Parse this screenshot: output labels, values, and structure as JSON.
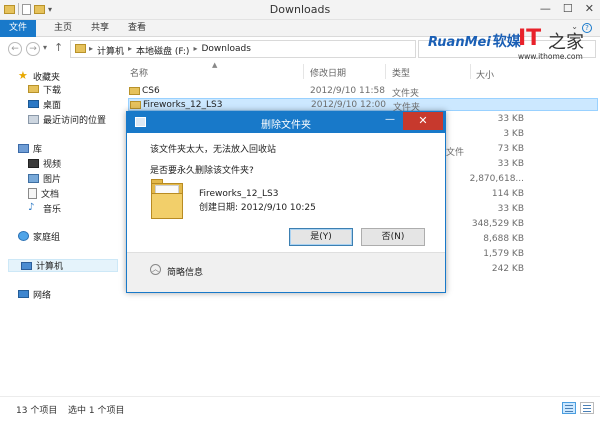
{
  "window": {
    "title": "Downloads",
    "controls": {
      "minimize": "—",
      "maximize": "☐",
      "close": "✕"
    }
  },
  "ribbon": {
    "tabs": [
      {
        "label": "文件",
        "active": true
      },
      {
        "label": "主页",
        "active": false
      },
      {
        "label": "共享",
        "active": false
      },
      {
        "label": "查看",
        "active": false
      }
    ],
    "help_icon": "?"
  },
  "address": {
    "back_icon": "←",
    "forward_icon": "→",
    "up_icon": "↑",
    "crumbs": [
      "计算机",
      "本地磁盘 (F:)",
      "Downloads"
    ],
    "separator": "▸"
  },
  "watermarks": {
    "ruanmei": {
      "latin": "RuanMei",
      "cn": "软媒"
    },
    "ithome": {
      "it": "IT",
      "cn": "之家",
      "url": "www.ithome.com"
    }
  },
  "sidebar": {
    "favorites": {
      "header": "收藏夹",
      "items": [
        "下载",
        "桌面",
        "最近访问的位置"
      ]
    },
    "libraries": {
      "header": "库",
      "items": [
        "视频",
        "图片",
        "文档",
        "音乐"
      ]
    },
    "homegroup": "家庭组",
    "computer": "计算机",
    "network": "网络"
  },
  "filelist": {
    "columns": {
      "name": "名称",
      "date": "修改日期",
      "type": "类型",
      "size": "大小"
    },
    "rows": [
      {
        "name": "CS6",
        "date": "2012/9/10 11:58",
        "type": "文件夹",
        "size": "",
        "selected": false
      },
      {
        "name": "Fireworks_12_LS3",
        "date": "2012/9/10 12:00",
        "type": "文件夹",
        "size": "",
        "selected": true
      }
    ],
    "partial_type": "文件",
    "sizes": [
      "33 KB",
      "3 KB",
      "73 KB",
      "33 KB",
      "2,870,618...",
      "114 KB",
      "33 KB",
      "348,529 KB",
      "8,688 KB",
      "1,579 KB",
      "242 KB"
    ]
  },
  "dialog": {
    "title": "删除文件夹",
    "line1": "该文件夹太大，无法放入回收站",
    "line2": "是否要永久删除该文件夹?",
    "folder_name": "Fireworks_12_LS3",
    "created": "创建日期: 2012/9/10 10:25",
    "yes": "是(Y)",
    "no": "否(N)",
    "more_info": "简略信息",
    "minimize": "—",
    "close": "✕"
  },
  "statusbar": {
    "count": "13 个项目",
    "selected": "选中 1 个项目"
  }
}
